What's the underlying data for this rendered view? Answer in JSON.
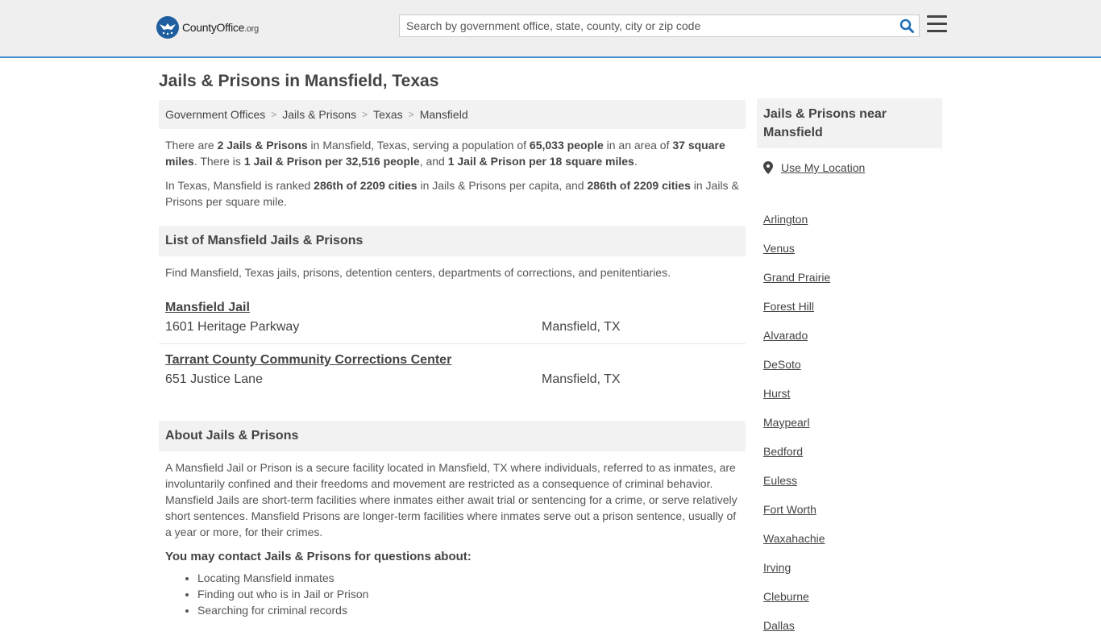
{
  "header": {
    "logo_text": "CountyOffice",
    "logo_suffix": ".org",
    "search_placeholder": "Search by government office, state, county, city or zip code"
  },
  "page_title": "Jails & Prisons in Mansfield, Texas",
  "breadcrumb": [
    "Government Offices",
    "Jails & Prisons",
    "Texas",
    "Mansfield"
  ],
  "intro": {
    "p1": [
      {
        "t": "There are ",
        "b": false
      },
      {
        "t": "2 Jails & Prisons",
        "b": true
      },
      {
        "t": " in Mansfield, Texas, serving a population of ",
        "b": false
      },
      {
        "t": "65,033 people",
        "b": true
      },
      {
        "t": " in an area of ",
        "b": false
      },
      {
        "t": "37 square miles",
        "b": true
      },
      {
        "t": ". There is ",
        "b": false
      },
      {
        "t": "1 Jail & Prison per 32,516 people",
        "b": true
      },
      {
        "t": ", and ",
        "b": false
      },
      {
        "t": "1 Jail & Prison per 18 square miles",
        "b": true
      },
      {
        "t": ".",
        "b": false
      }
    ],
    "p2": [
      {
        "t": "In Texas, Mansfield is ranked ",
        "b": false
      },
      {
        "t": "286th of 2209 cities",
        "b": true
      },
      {
        "t": " in Jails & Prisons per capita, and ",
        "b": false
      },
      {
        "t": "286th of 2209 cities",
        "b": true
      },
      {
        "t": " in Jails & Prisons per square mile.",
        "b": false
      }
    ]
  },
  "list_section": {
    "title": "List of Mansfield Jails & Prisons",
    "description": "Find Mansfield, Texas jails, prisons, detention centers, departments of corrections, and penitentiaries.",
    "items": [
      {
        "name": "Mansfield Jail",
        "address": "1601 Heritage Parkway",
        "city": "Mansfield, TX"
      },
      {
        "name": "Tarrant County Community Corrections Center",
        "address": "651 Justice Lane",
        "city": "Mansfield, TX"
      }
    ]
  },
  "about": {
    "title": "About Jails & Prisons",
    "text": "A Mansfield Jail or Prison is a secure facility located in Mansfield, TX where individuals, referred to as inmates, are involuntarily confined and their freedoms and movement are restricted as a consequence of criminal behavior. Mansfield Jails are short-term facilities where inmates either await trial or sentencing for a crime, or serve relatively short sentences. Mansfield Prisons are longer-term facilities where inmates serve out a prison sentence, usually of a year or more, for their crimes.",
    "contact_title": "You may contact Jails & Prisons for questions about:",
    "contact_items": [
      "Locating Mansfield inmates",
      "Finding out who is in Jail or Prison",
      "Searching for criminal records"
    ]
  },
  "sidebar": {
    "title": "Jails & Prisons near Mansfield",
    "use_location": "Use My Location",
    "cities": [
      "Arlington",
      "Venus",
      "Grand Prairie",
      "Forest Hill",
      "Alvarado",
      "DeSoto",
      "Hurst",
      "Maypearl",
      "Bedford",
      "Euless",
      "Fort Worth",
      "Waxahachie",
      "Irving",
      "Cleburne",
      "Dallas"
    ]
  },
  "colors": {
    "accent": "#4a8fd0",
    "logo_blue": "#1f5f9f",
    "search_icon": "#1f6fb8"
  }
}
